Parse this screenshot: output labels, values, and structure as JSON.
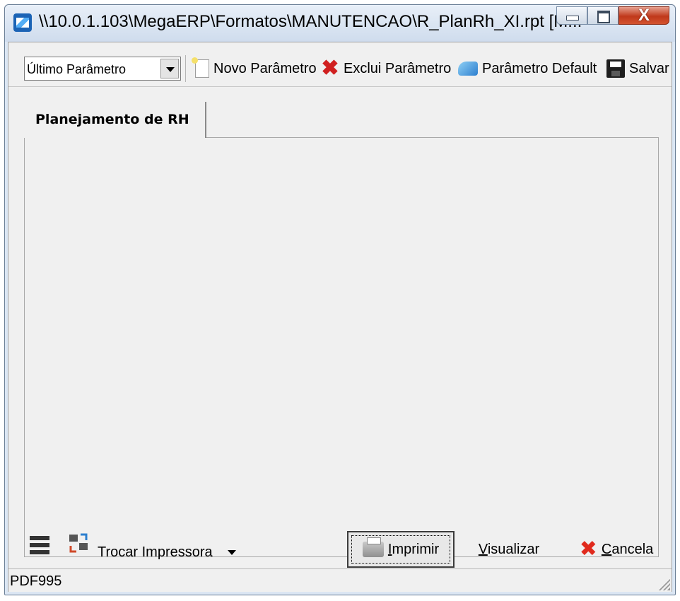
{
  "window": {
    "title": "\\\\10.0.1.103\\MegaERP\\Formatos\\MANUTENCAO\\R_PlanRh_XI.rpt [M...",
    "controls": {
      "minimize": "minimize",
      "maximize": "maximize",
      "close": "X"
    }
  },
  "toolbar": {
    "parameter_select": {
      "value": "Último Parâmetro"
    },
    "new_parameter": "Novo Parâmetro",
    "delete_parameter": "Exclui Parâmetro",
    "default_parameter": "Parâmetro Default",
    "save": "Salvar"
  },
  "tabs": [
    {
      "label": "Planejamento de RH",
      "active": true
    }
  ],
  "bottom": {
    "change_printer": "Trocar Impressora",
    "print": "Imprimir",
    "preview": "Visualizar",
    "cancel": "Cancela"
  },
  "status": {
    "printer": "PDF995"
  },
  "icons": [
    "app-icon",
    "new-document-icon",
    "delete-icon",
    "default-icon",
    "save-disk-icon",
    "printer-settings-icon",
    "swap-printer-icon",
    "print-icon",
    "cancel-x-icon"
  ],
  "colors": {
    "titlebar": "#cfdced",
    "close_button": "#c0391b",
    "client_bg": "#f0f0f0",
    "cancel_icon": "#e02a1d"
  }
}
